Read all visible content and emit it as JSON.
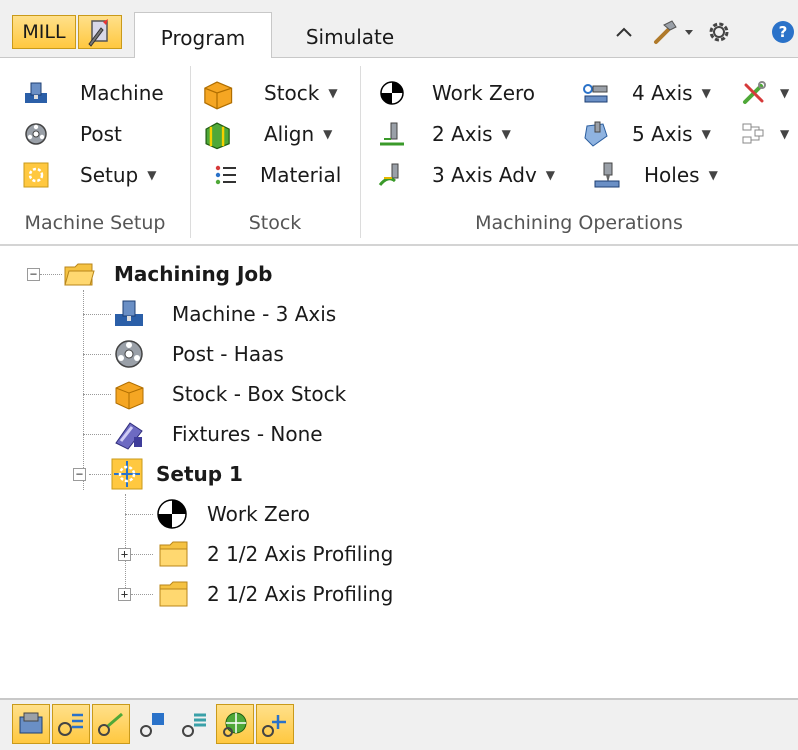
{
  "tabs": {
    "mill": "MILL",
    "program": "Program",
    "simulate": "Simulate"
  },
  "ribbon": {
    "machine_setup": {
      "label": "Machine Setup",
      "machine": "Machine",
      "post": "Post",
      "setup": "Setup"
    },
    "stock": {
      "label": "Stock",
      "stock": "Stock",
      "align": "Align",
      "material": "Material"
    },
    "machining_operations": {
      "label": "Machining Operations",
      "work_zero": "Work Zero",
      "two_axis": "2 Axis",
      "three_axis_adv": "3 Axis Adv",
      "four_axis": "4 Axis",
      "five_axis": "5 Axis",
      "holes": "Holes"
    }
  },
  "tree": {
    "root": "Machining Job",
    "machine": "Machine - 3 Axis",
    "post": "Post - Haas",
    "stock": "Stock - Box Stock",
    "fixtures": "Fixtures - None",
    "setup": "Setup 1",
    "work_zero": "Work Zero",
    "op1": "2 1/2 Axis Profiling",
    "op2": "2 1/2 Axis Profiling"
  },
  "colors": {
    "accent_yellow": "#ffc840",
    "folder": "#f5c242",
    "tab_bg": "#f0f0f0"
  }
}
